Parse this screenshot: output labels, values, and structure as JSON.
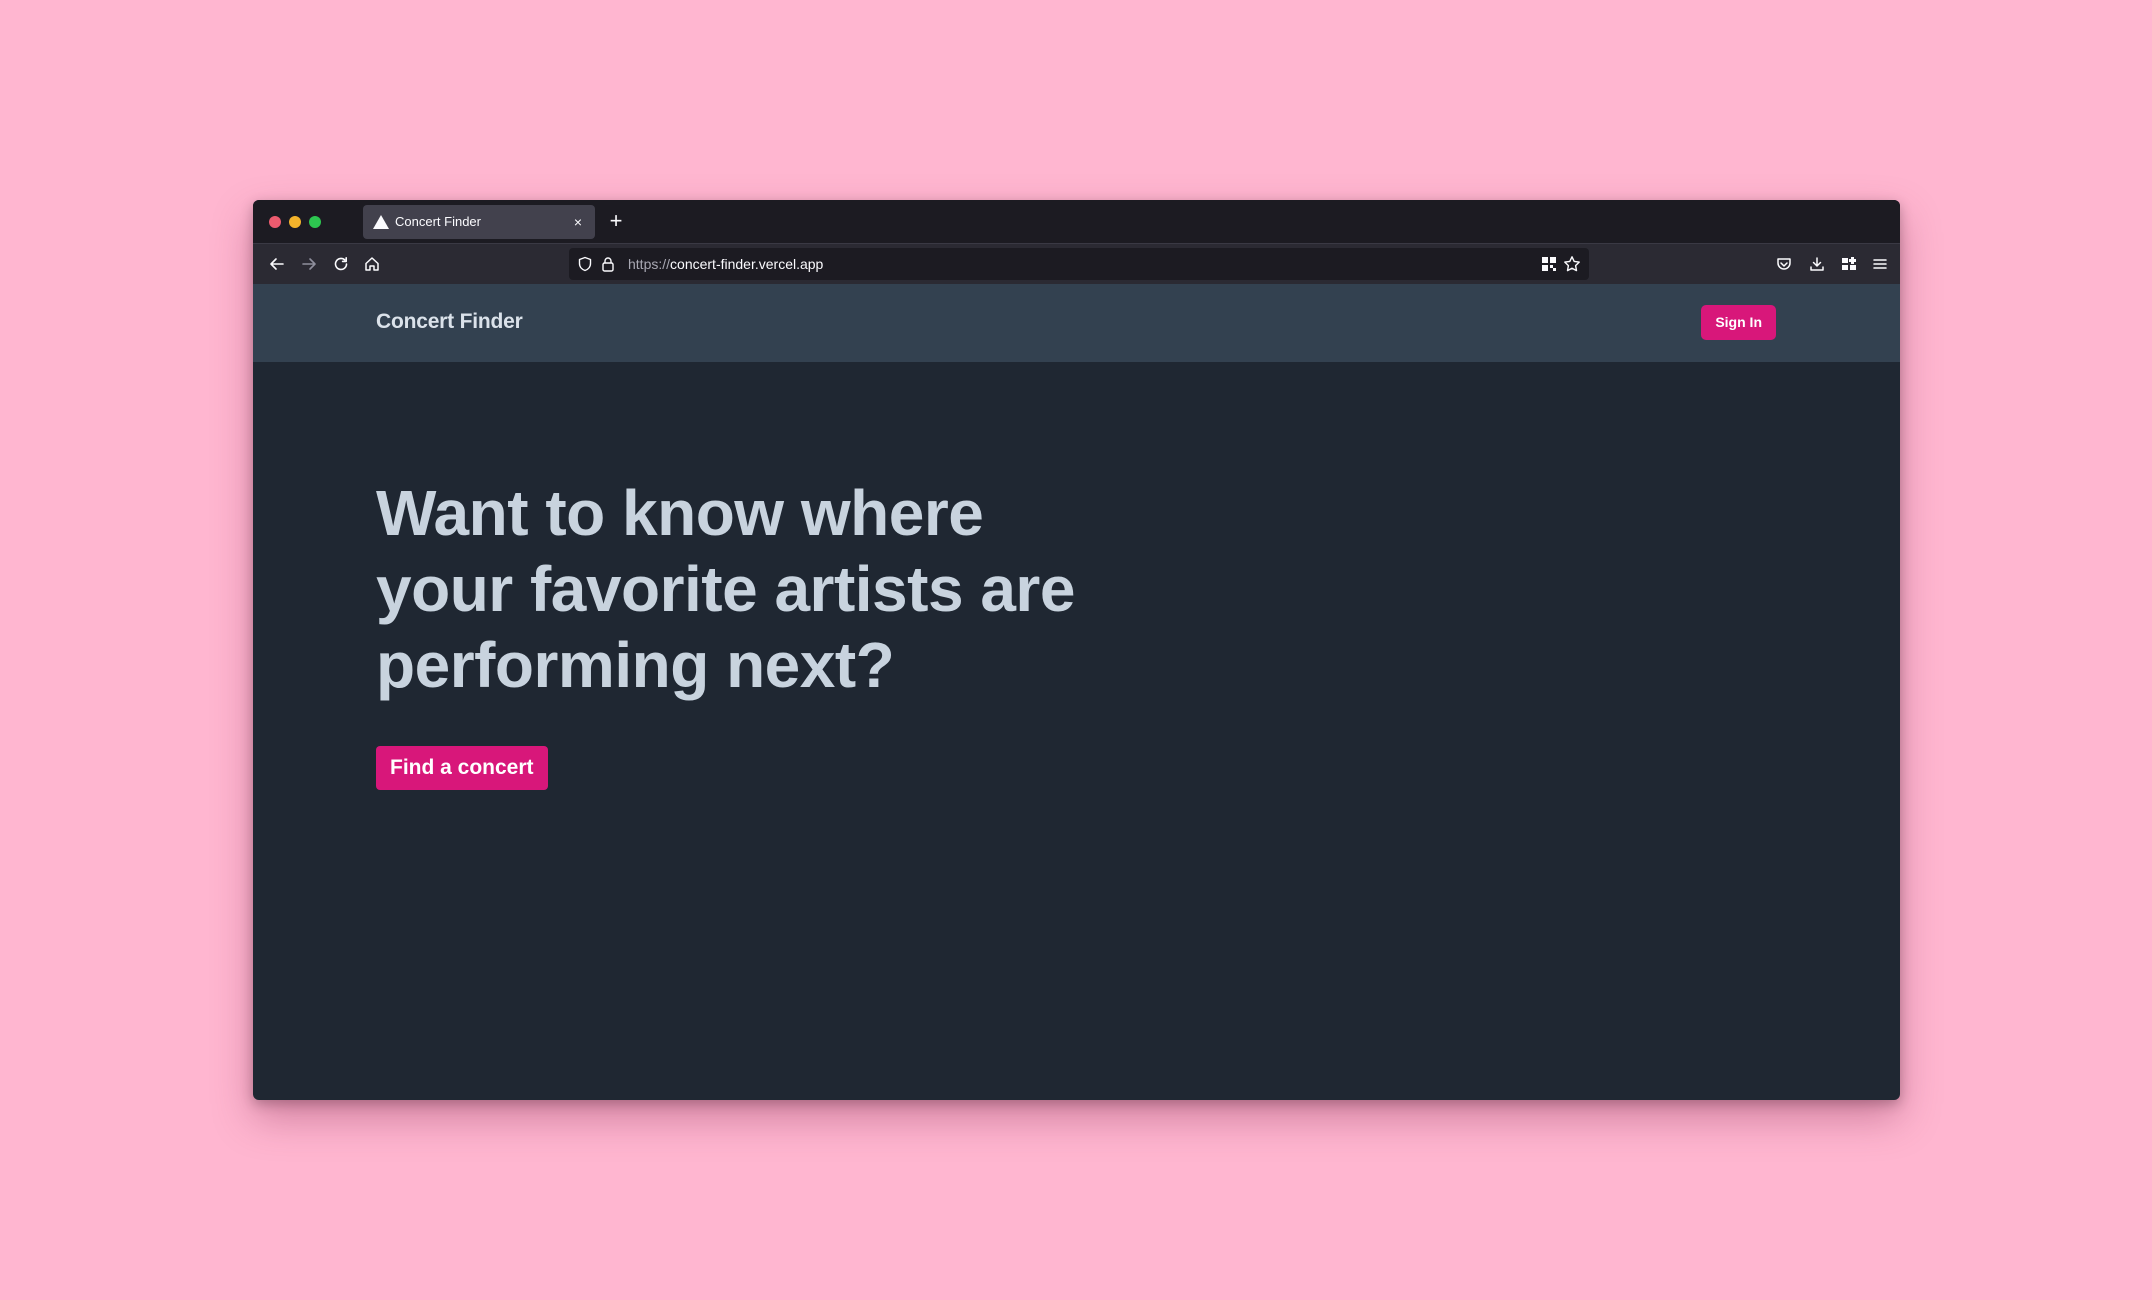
{
  "browser": {
    "tab": {
      "title": "Concert Finder",
      "close_glyph": "×",
      "favicon": "triangle-icon"
    },
    "new_tab_glyph": "+",
    "url": {
      "scheme": "https://",
      "host": "concert-finder.vercel.app"
    },
    "icons": [
      "back-arrow-icon",
      "forward-arrow-icon",
      "reload-icon",
      "home-icon",
      "shield-icon",
      "lock-icon",
      "qr-code-icon",
      "star-icon",
      "pocket-icon",
      "download-icon",
      "extensions-icon",
      "hamburger-menu-icon"
    ]
  },
  "site": {
    "brand": "Concert Finder",
    "signin_label": "Sign In",
    "hero_title": "Want to know where your favorite artists are performing next?",
    "cta_label": "Find a concert"
  },
  "colors": {
    "page_background": "#ffb6d0",
    "browser_chrome": "#1c1b22",
    "site_header": "#334150",
    "site_body": "#1f2732",
    "accent": "#d8177a",
    "hero_text": "#c8d3de"
  }
}
